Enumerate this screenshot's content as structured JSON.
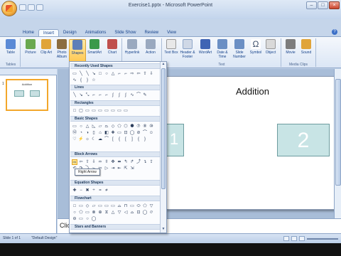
{
  "window": {
    "title": "Exercise1.pptx - Microsoft PowerPoint"
  },
  "tabs": [
    "Home",
    "Insert",
    "Design",
    "Animations",
    "Slide Show",
    "Review",
    "View"
  ],
  "active_tab": "Insert",
  "ribbon": {
    "buttons": [
      {
        "label": "Table",
        "icon": "table-icon",
        "color": "#5b8ad6"
      },
      {
        "label": "Picture",
        "icon": "picture-icon",
        "color": "#6aa84f"
      },
      {
        "label": "Clip Art",
        "icon": "clipart-icon",
        "color": "#e0a43a"
      },
      {
        "label": "Photo Album",
        "icon": "photo-album-icon",
        "color": "#8c6d3f"
      },
      {
        "label": "Shapes",
        "icon": "shapes-icon",
        "color": "#5e7fb8"
      },
      {
        "label": "SmartArt",
        "icon": "smartart-icon",
        "color": "#3a9a4a"
      },
      {
        "label": "Chart",
        "icon": "chart-icon",
        "color": "#c0504d"
      },
      {
        "label": "Hyperlink",
        "icon": "hyperlink-icon",
        "color": "#9aa9bf"
      },
      {
        "label": "Action",
        "icon": "action-icon",
        "color": "#9aa9bf"
      },
      {
        "label": "Text Box",
        "icon": "textbox-icon",
        "color": "#e8e8e8"
      },
      {
        "label": "Header & Footer",
        "icon": "header-footer-icon",
        "color": "#cfd8e6"
      },
      {
        "label": "WordArt",
        "icon": "wordart-icon",
        "color": "#3f64b4"
      },
      {
        "label": "Date & Time",
        "icon": "date-time-icon",
        "color": "#6b8fc4"
      },
      {
        "label": "Slide Number",
        "icon": "slide-number-icon",
        "color": "#6b8fc4"
      },
      {
        "label": "Symbol",
        "icon": "symbol-icon",
        "color": "#3b4d69"
      },
      {
        "label": "Object",
        "icon": "object-icon",
        "color": "#d9d9d9"
      },
      {
        "label": "Movie",
        "icon": "movie-icon",
        "color": "#7d7d7d"
      },
      {
        "label": "Sound",
        "icon": "sound-icon",
        "color": "#e0a43a"
      }
    ],
    "groups": [
      "Tables",
      "Illustrations",
      "Links",
      "Text",
      "Media Clips"
    ]
  },
  "gallery": {
    "sections": [
      "Recently Used Shapes",
      "Lines",
      "Rectangles",
      "Basic Shapes",
      "Block Arrows",
      "Equation Shapes",
      "Flowchart",
      "Stars and Banners"
    ],
    "tooltip": "Right Arrow"
  },
  "slide": {
    "title": "Addition",
    "box1_text": "1",
    "box2_text": "2",
    "thumb_number": "1",
    "thumb_title": "Addition"
  },
  "notes": {
    "text": "Click to add notes"
  },
  "status": {
    "slide": "Slide 1 of 1",
    "theme": "\"Default Design\""
  }
}
